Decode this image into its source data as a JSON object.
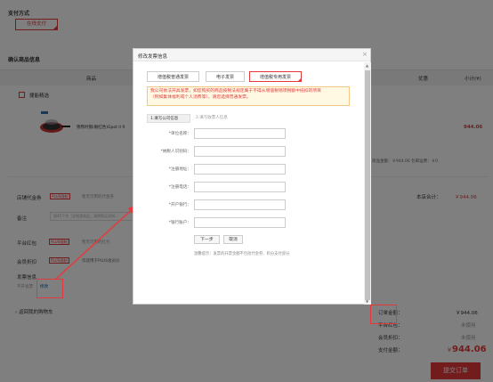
{
  "payment": {
    "title": "支付方式",
    "online_pay": "在线支付"
  },
  "confirm": {
    "title": "确认商品信息"
  },
  "table_head": {
    "product": "商品",
    "discount": "优惠",
    "subtotal": "小计(¥)"
  },
  "shop": {
    "name": "捷能精选"
  },
  "product": {
    "name": "锦熊时钢(眼红色)Gpot II 9",
    "price": "944.06",
    "summary": "商品金额：￥944.06 包邮运费：￥0"
  },
  "shop_coupon": {
    "label": "店铺代金券",
    "tag": "PLUS限制",
    "text": "暂无可用的代金券"
  },
  "store_total": {
    "label": "本店合计：",
    "value": "￥944.06"
  },
  "remark": {
    "label": "备注",
    "placeholder": "限45个字（定制类商品，请将购买须知..."
  },
  "platform_redpack": {
    "label": "平台红包",
    "tag": "PLUS限制",
    "text": "暂无可用的红包"
  },
  "member_discount": {
    "label": "会员折扣",
    "tag": "PLUS限制",
    "text": "仅适用于PLUS会员价"
  },
  "invoice": {
    "label": "发票信息",
    "status": "不开发票",
    "edit": "修改"
  },
  "back_link": "返回我的购物车",
  "summary": {
    "rows": [
      {
        "label": "订单金额：",
        "value": "￥944.06"
      },
      {
        "label": "平台红包：",
        "value": "未使用"
      },
      {
        "label": "会员折扣：",
        "value": "未使用"
      }
    ],
    "pay_label": "支付金额：",
    "pay_value": "944.06",
    "pay_currency": "￥",
    "submit": "提交订单"
  },
  "modal": {
    "title": "修改发票信息",
    "close": "×",
    "tabs": [
      "增值税普通发票",
      "电子发票",
      "增值税专用发票"
    ],
    "notice_line1": "我公司依法开具发票，如您购买的商品按税法规定属于不得从增值税销项税额中抵扣的项目",
    "notice_line2": "（例如集体福利或个人消费等），请您选择普通发票。",
    "steps": [
      "1.填写公司信息",
      "2.填写收票人信息"
    ],
    "fields": [
      {
        "label": "*单位名称："
      },
      {
        "label": "*纳税人识别码："
      },
      {
        "label": "*注册地址："
      },
      {
        "label": "*注册电话："
      },
      {
        "label": "*开户银行："
      },
      {
        "label": "*银行账户："
      }
    ],
    "next_btn": "下一步",
    "cancel_btn": "取消",
    "tip": "温馨提示：发票的开票金额不包括代金券、积分支付部分"
  },
  "colors": {
    "accent": "#e4393c",
    "overlay": "rgba(0,0,0,0.5)"
  }
}
